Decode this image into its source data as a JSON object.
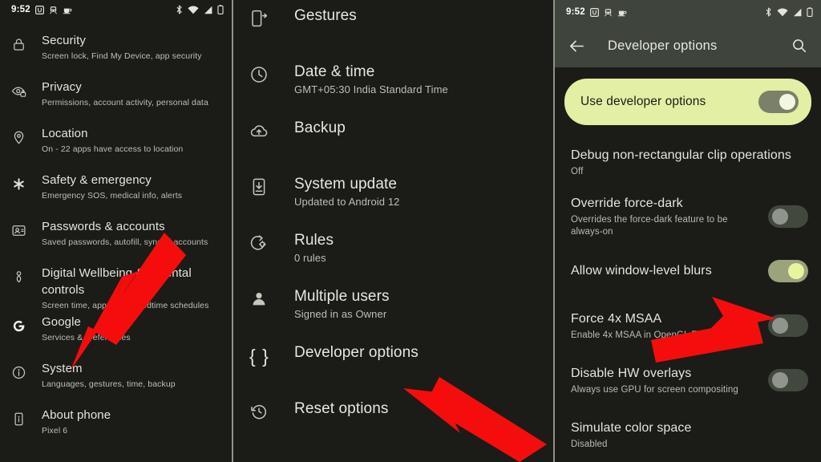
{
  "colors": {
    "background": "#1b1c18",
    "toolbar": "#3f443c",
    "accent_card": "#e2efa4",
    "arrow": "#f50d0d",
    "divider": "#8d9285",
    "title_text": "#e4e4dc",
    "sub_text": "#bdbfb4"
  },
  "status_bar": {
    "time": "9:52",
    "left_icons": [
      "u-badge-icon",
      "train-icon",
      "coffee-icon"
    ],
    "right_icons": [
      "bluetooth-icon",
      "wifi-icon",
      "signal-icon",
      "battery-icon"
    ]
  },
  "left_panel": {
    "items": [
      {
        "icon": "lock-icon",
        "title": "Security",
        "subtitle": "Screen lock, Find My Device, app security"
      },
      {
        "icon": "privacy-eye-icon",
        "title": "Privacy",
        "subtitle": "Permissions, account activity, personal data"
      },
      {
        "icon": "location-pin-icon",
        "title": "Location",
        "subtitle": "On - 22 apps have access to location"
      },
      {
        "icon": "asterisk-icon",
        "title": "Safety & emergency",
        "subtitle": "Emergency SOS, medical info, alerts"
      },
      {
        "icon": "id-card-icon",
        "title": "Passwords & accounts",
        "subtitle": "Saved passwords, autofill, synced accounts"
      },
      {
        "icon": "wellbeing-icon",
        "title": "Digital Wellbeing & parental controls",
        "subtitle": "Screen time, app timers, bedtime schedules"
      },
      {
        "icon": "google-g-icon",
        "title": "Google",
        "subtitle": "Services & preferences"
      },
      {
        "icon": "info-circle-icon",
        "title": "System",
        "subtitle": "Languages, gestures, time, backup"
      },
      {
        "icon": "phone-info-icon",
        "title": "About phone",
        "subtitle": "Pixel 6"
      }
    ]
  },
  "middle_panel": {
    "items": [
      {
        "icon": "gestures-icon",
        "title": "Gestures",
        "subtitle": ""
      },
      {
        "icon": "clock-icon",
        "title": "Date & time",
        "subtitle": "GMT+05:30 India Standard Time"
      },
      {
        "icon": "cloud-upload-icon",
        "title": "Backup",
        "subtitle": ""
      },
      {
        "icon": "system-update-icon",
        "title": "System update",
        "subtitle": "Updated to Android 12"
      },
      {
        "icon": "rules-gear-icon",
        "title": "Rules",
        "subtitle": "0 rules"
      },
      {
        "icon": "person-icon",
        "title": "Multiple users",
        "subtitle": "Signed in as Owner"
      },
      {
        "icon": "braces-icon",
        "title": "Developer options",
        "subtitle": ""
      },
      {
        "icon": "history-reset-icon",
        "title": "Reset options",
        "subtitle": ""
      }
    ]
  },
  "right_panel": {
    "toolbar": {
      "back_icon": "arrow-back-icon",
      "title": "Developer options",
      "search_icon": "search-icon"
    },
    "master_switch": {
      "label": "Use developer options",
      "state": "on"
    },
    "items": [
      {
        "title": "Debug non-rectangular clip operations",
        "subtitle": "Off",
        "toggle": "none"
      },
      {
        "title": "Override force-dark",
        "subtitle": "Overrides the force-dark feature to be always-on",
        "toggle": "off"
      },
      {
        "title": "Allow window-level blurs",
        "subtitle": "",
        "toggle": "on"
      },
      {
        "title": "Force 4x MSAA",
        "subtitle": "Enable 4x MSAA in OpenGL ES 2.0 apps",
        "toggle": "off"
      },
      {
        "title": "Disable HW overlays",
        "subtitle": "Always use GPU for screen compositing",
        "toggle": "off"
      },
      {
        "title": "Simulate color space",
        "subtitle": "Disabled",
        "toggle": "none"
      }
    ]
  },
  "annotations": {
    "arrows": [
      {
        "name": "arrow-pointing-to-system",
        "points_at": "System"
      },
      {
        "name": "arrow-pointing-to-developer-options",
        "points_at": "Developer options"
      },
      {
        "name": "arrow-pointing-to-force-4x-msaa-toggle",
        "points_at": "Force 4x MSAA"
      }
    ]
  }
}
